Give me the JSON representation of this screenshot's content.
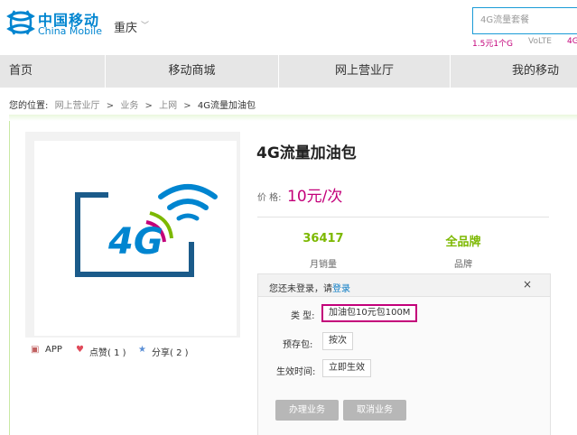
{
  "header": {
    "logo_cn": "中国移动",
    "logo_en": "China Mobile",
    "city": "重庆",
    "search_placeholder": "4G流量套餐",
    "hot_links": [
      "1.5元1个G",
      "VoLTE",
      "4G"
    ]
  },
  "nav": {
    "items": [
      "首页",
      "移动商城",
      "网上营业厅",
      "我的移动"
    ]
  },
  "breadcrumb": {
    "prefix": "您的位置:",
    "links": [
      "网上营业厅",
      "业务",
      "上网"
    ],
    "current": "4G流量加油包",
    "separator": ">"
  },
  "product": {
    "title": "4G流量加油包",
    "price_label": "价 格:",
    "price": "10元/次",
    "stats": [
      {
        "value": "36417",
        "label": "月销量"
      },
      {
        "value": "全品牌",
        "label": "品牌"
      }
    ],
    "image_text": "4G"
  },
  "actions": {
    "app": "APP",
    "like": "点赞( 1 )",
    "share": "分享( 2 )"
  },
  "order_panel": {
    "login_text": "您还未登录，请",
    "login_link": "登录",
    "close": "×",
    "rows": [
      {
        "label": "类   型:",
        "option": "加油包10元包100M",
        "selected": true
      },
      {
        "label": "预存包:",
        "option": "按次",
        "selected": false
      },
      {
        "label": "生效时间:",
        "option": "立即生效",
        "selected": false
      }
    ],
    "submit": "办理业务",
    "cancel": "取消业务"
  },
  "colors": {
    "brand_blue": "#0085d0",
    "accent_magenta": "#c3007a",
    "stat_green": "#7cb800",
    "nav_gray": "#e6e6e6"
  }
}
